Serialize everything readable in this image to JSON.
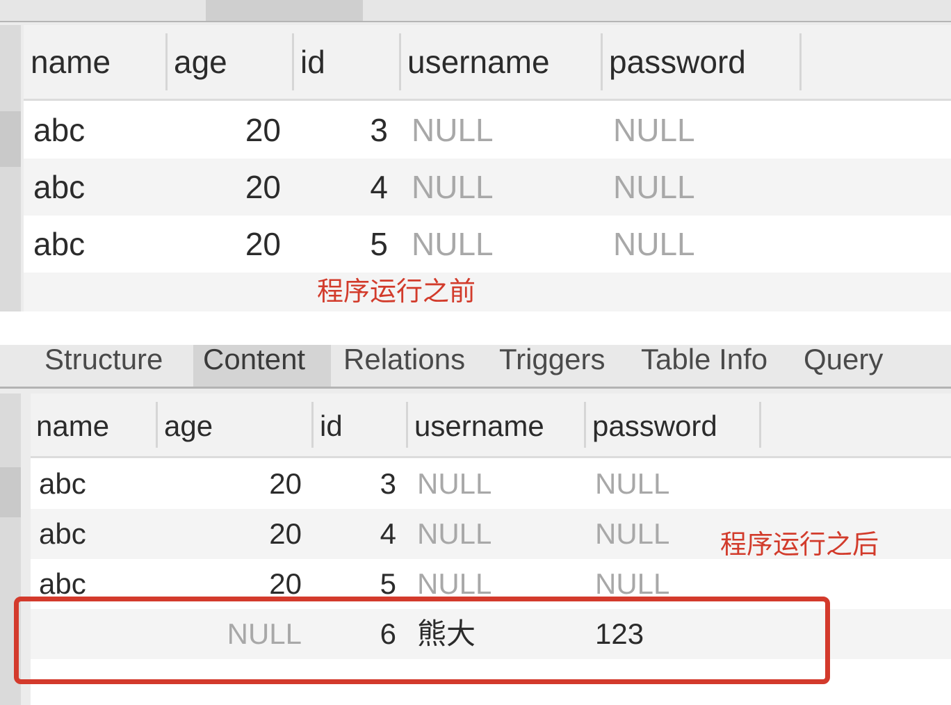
{
  "before_label": "程序运行之前",
  "after_label": "程序运行之后",
  "tabs": [
    {
      "label": "Structure",
      "active": false
    },
    {
      "label": "Content",
      "active": true
    },
    {
      "label": "Relations",
      "active": false
    },
    {
      "label": "Triggers",
      "active": false
    },
    {
      "label": "Table Info",
      "active": false
    },
    {
      "label": "Query",
      "active": false
    }
  ],
  "columns": [
    "name",
    "age",
    "id",
    "username",
    "password"
  ],
  "before_rows": [
    {
      "name": "abc",
      "age": "20",
      "id": "3",
      "username": "NULL",
      "password": "NULL"
    },
    {
      "name": "abc",
      "age": "20",
      "id": "4",
      "username": "NULL",
      "password": "NULL"
    },
    {
      "name": "abc",
      "age": "20",
      "id": "5",
      "username": "NULL",
      "password": "NULL"
    }
  ],
  "after_rows": [
    {
      "name": "abc",
      "age": "20",
      "id": "3",
      "username": "NULL",
      "password": "NULL"
    },
    {
      "name": "abc",
      "age": "20",
      "id": "4",
      "username": "NULL",
      "password": "NULL"
    },
    {
      "name": "abc",
      "age": "20",
      "id": "5",
      "username": "NULL",
      "password": "NULL"
    },
    {
      "name": "",
      "age": "NULL",
      "id": "6",
      "username": "熊大",
      "password": "123"
    }
  ],
  "colors": {
    "annotation": "#d23b2b",
    "highlight_border": "#d33a2c",
    "null_text": "#a8a8a8"
  }
}
